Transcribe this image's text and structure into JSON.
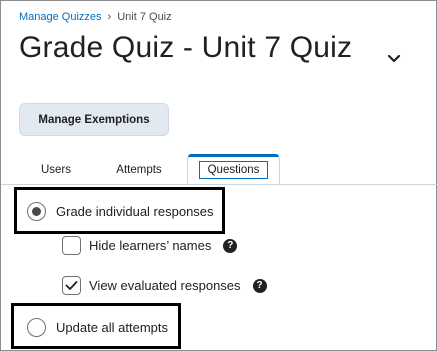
{
  "breadcrumb": {
    "link": "Manage Quizzes",
    "separator": "›",
    "current": "Unit 7 Quiz"
  },
  "page": {
    "title": "Grade Quiz - Unit 7 Quiz"
  },
  "actions": {
    "manage_exemptions": "Manage Exemptions"
  },
  "tabs": [
    {
      "label": "Users",
      "selected": false
    },
    {
      "label": "Attempts",
      "selected": false
    },
    {
      "label": "Questions",
      "selected": true
    }
  ],
  "options": {
    "grade_individual": {
      "label": "Grade individual responses",
      "selected": true
    },
    "hide_names": {
      "label": "Hide learners’ names",
      "checked": false,
      "help_icon": "help-circle-icon"
    },
    "view_evaluated": {
      "label": "View evaluated responses",
      "checked": true,
      "help_icon": "help-circle-icon"
    },
    "update_all": {
      "label": "Update all attempts",
      "selected": false
    }
  },
  "colors": {
    "link": "#006fbf",
    "button_bg": "#e3e9f1",
    "tab_selected": "#006fbf",
    "highlight_box": "#000000"
  }
}
